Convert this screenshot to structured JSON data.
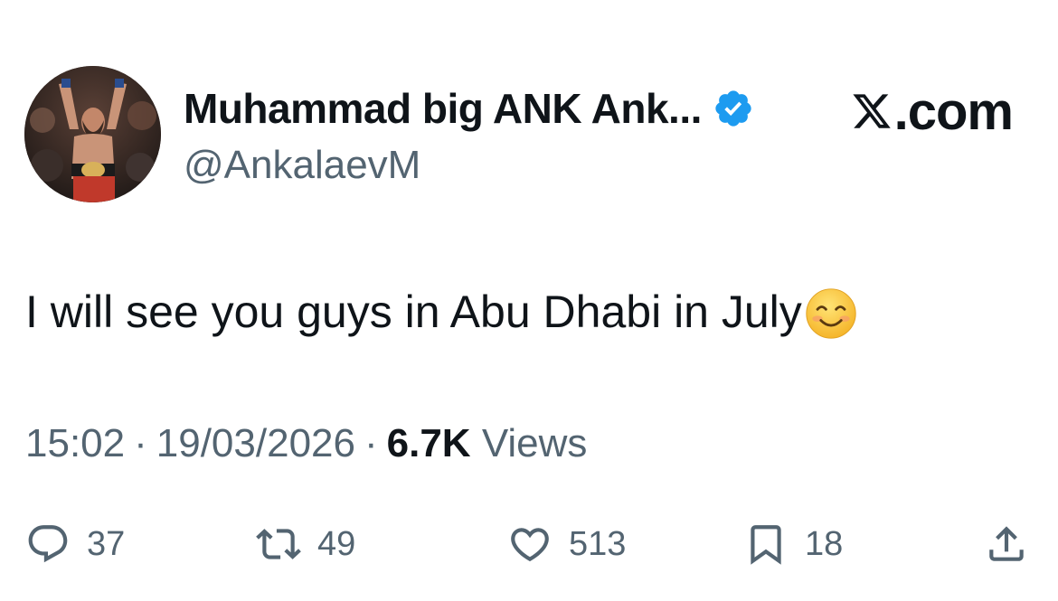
{
  "author": {
    "display_name": "Muhammad big ANK Ank...",
    "handle": "@AnkalaevM",
    "verified": true,
    "avatar": "avatar-photo-fighter-with-belt"
  },
  "brand": {
    "site_label": ".com",
    "logo_icon": "x-logo-icon"
  },
  "tweet": {
    "text": "I will see you guys in Abu Dhabi in July",
    "emoji": "smiling-face-emoji"
  },
  "meta": {
    "time": "15:02",
    "separator": "·",
    "date": "19/03/2026",
    "views_count": "6.7K",
    "views_label": "Views"
  },
  "actions": {
    "replies": "37",
    "reposts": "49",
    "likes": "513",
    "bookmarks": "18"
  },
  "colors": {
    "text": "#0f1419",
    "secondary": "#536471",
    "verified_blue": "#1d9bf0"
  }
}
